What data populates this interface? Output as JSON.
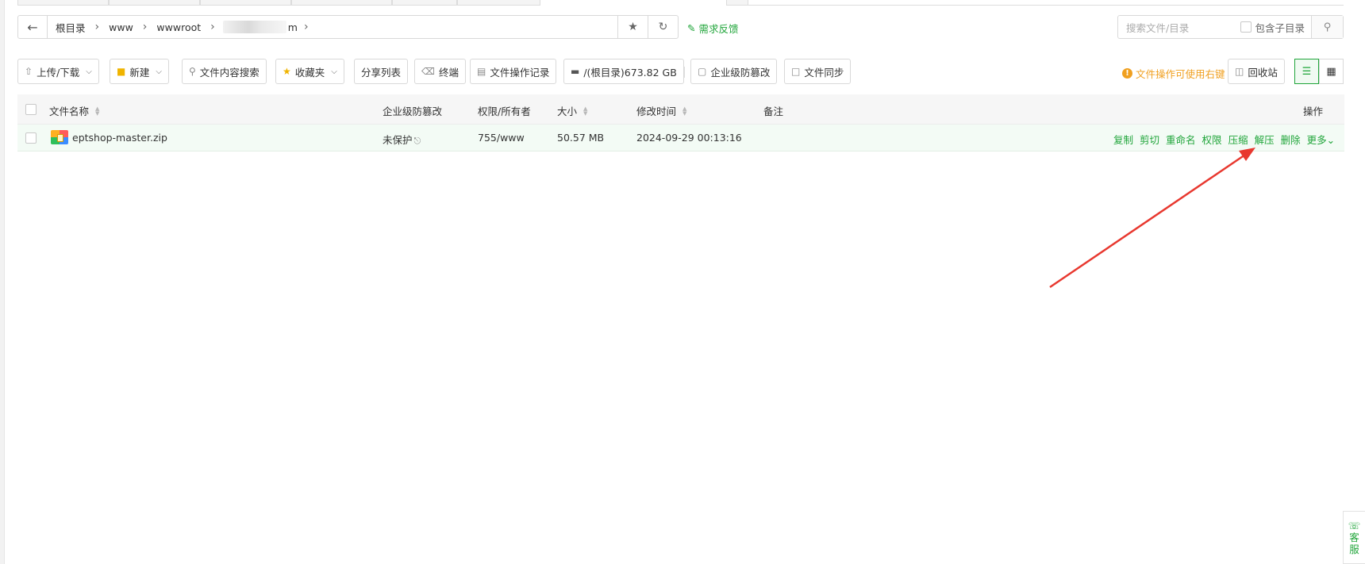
{
  "breadcrumb": {
    "items": [
      "根目录",
      "www",
      "wwwroot"
    ],
    "tail": "m"
  },
  "header": {
    "feedback_label": "需求反馈"
  },
  "search": {
    "placeholder": "搜索文件/目录",
    "include_subdir_label": "包含子目录"
  },
  "toolbar": {
    "upload_label": "上传/下载",
    "new_label": "新建",
    "content_search_label": "文件内容搜索",
    "favorites_label": "收藏夹",
    "share_list_label": "分享列表",
    "terminal_label": "终端",
    "op_log_label": "文件操作记录",
    "disk_label": "/(根目录)673.82 GB",
    "tamper_label": "企业级防篡改",
    "sync_label": "文件同步",
    "hint_label": "文件操作可使用右键",
    "recycle_label": "回收站"
  },
  "table": {
    "columns": {
      "name": "文件名称",
      "tamper": "企业级防篡改",
      "perm": "权限/所有者",
      "size": "大小",
      "mtime": "修改时间",
      "note": "备注",
      "ops": "操作"
    },
    "rows": [
      {
        "name": "eptshop-master.zip",
        "tamper": "未保护",
        "perm": "755/www",
        "size": "50.57 MB",
        "mtime": "2024-09-29 00:13:16",
        "note": "",
        "ops": [
          "复制",
          "剪切",
          "重命名",
          "权限",
          "压缩",
          "解压",
          "删除",
          "更多"
        ]
      }
    ]
  },
  "service": {
    "label_1": "客",
    "label_2": "服"
  },
  "colors": {
    "accent": "#20a53a",
    "warning": "#f0a020",
    "annotation_arrow": "#e8382f"
  }
}
